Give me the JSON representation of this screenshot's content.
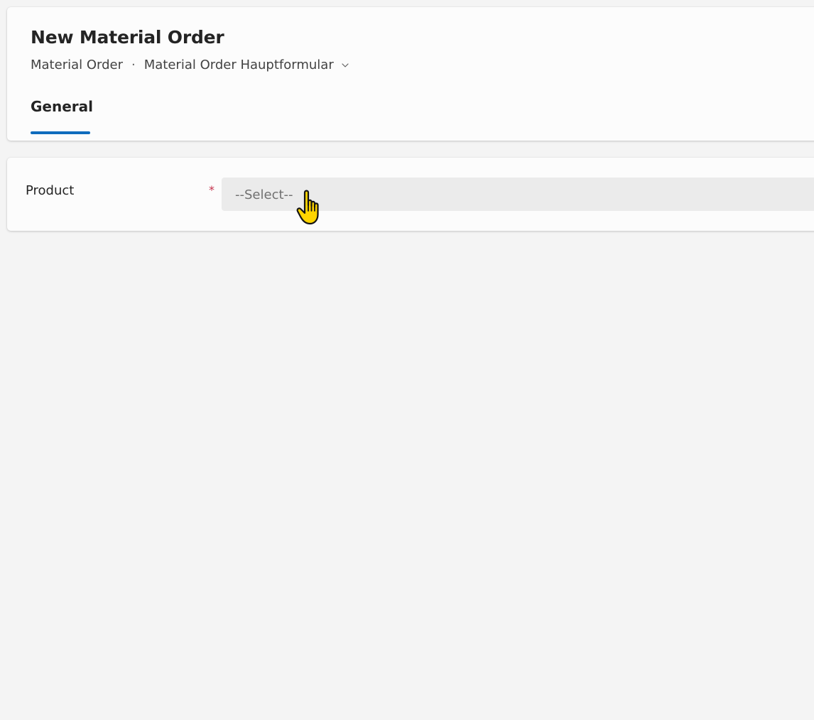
{
  "header": {
    "title": "New Material Order",
    "entity_name": "Material Order",
    "separator": "·",
    "form_name": "Material Order Hauptformular"
  },
  "tabs": [
    {
      "label": "General",
      "selected": true
    }
  ],
  "form": {
    "product": {
      "label": "Product",
      "required_mark": "*",
      "placeholder": "--Select--"
    }
  },
  "colors": {
    "accent": "#0f6cbd",
    "required": "#c4314b",
    "cursor": "#ffd400"
  },
  "icons": {
    "form_selector": "chevron-down-icon",
    "pointer": "hand-cursor-icon"
  }
}
